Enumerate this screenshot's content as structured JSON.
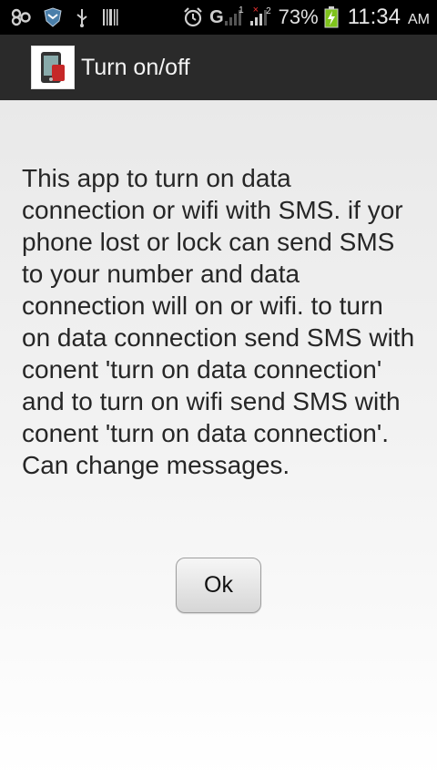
{
  "status_bar": {
    "battery_percent": "73%",
    "time": "11:34",
    "ampm": "AM",
    "signal_sup_1": "1",
    "signal_sup_2": "2",
    "icons": [
      "notification-icon",
      "shield-icon",
      "usb-icon",
      "barcode-icon",
      "alarm-icon",
      "signal-icon",
      "signal-icon",
      "battery-charging-icon"
    ]
  },
  "action_bar": {
    "title": "Turn on/off"
  },
  "dialog": {
    "message": "This app to turn on data connection or wifi with SMS. if yor phone lost or lock can send SMS to your number and data connection will on or wifi. to turn on data connection send SMS with conent 'turn on data connection' and to turn on wifi send SMS with conent 'turn on data connection'. Can change messages.",
    "ok_label": "Ok"
  },
  "colors": {
    "status_bar_bg": "#000000",
    "action_bar_bg": "#2a2a2a",
    "battery_green": "#7fc31c"
  }
}
